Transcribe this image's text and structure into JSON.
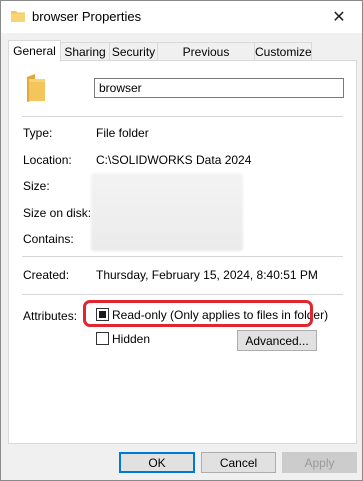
{
  "window": {
    "title": "browser Properties",
    "close_glyph": "✕"
  },
  "tabs": [
    {
      "label": "General",
      "active": true
    },
    {
      "label": "Sharing"
    },
    {
      "label": "Security"
    },
    {
      "label": "Previous Versions"
    },
    {
      "label": "Customize"
    }
  ],
  "general": {
    "folder_name": "browser",
    "type_label": "Type:",
    "type_value": "File folder",
    "location_label": "Location:",
    "location_value": "C:\\SOLIDWORKS Data 2024",
    "size_label": "Size:",
    "size_on_disk_label": "Size on disk:",
    "contains_label": "Contains:",
    "created_label": "Created:",
    "created_value": "Thursday, February 15, 2024, 8:40:51 PM",
    "attributes_label": "Attributes:",
    "readonly_label": "Read-only (Only applies to files in folder)",
    "readonly_state": "indeterminate",
    "hidden_label": "Hidden",
    "hidden_checked": false,
    "advanced_label": "Advanced..."
  },
  "footer": {
    "ok_label": "OK",
    "cancel_label": "Cancel",
    "apply_label": "Apply"
  },
  "colors": {
    "highlight": "#e0262f",
    "folder": "#f4c55a",
    "accent": "#0078d7"
  }
}
